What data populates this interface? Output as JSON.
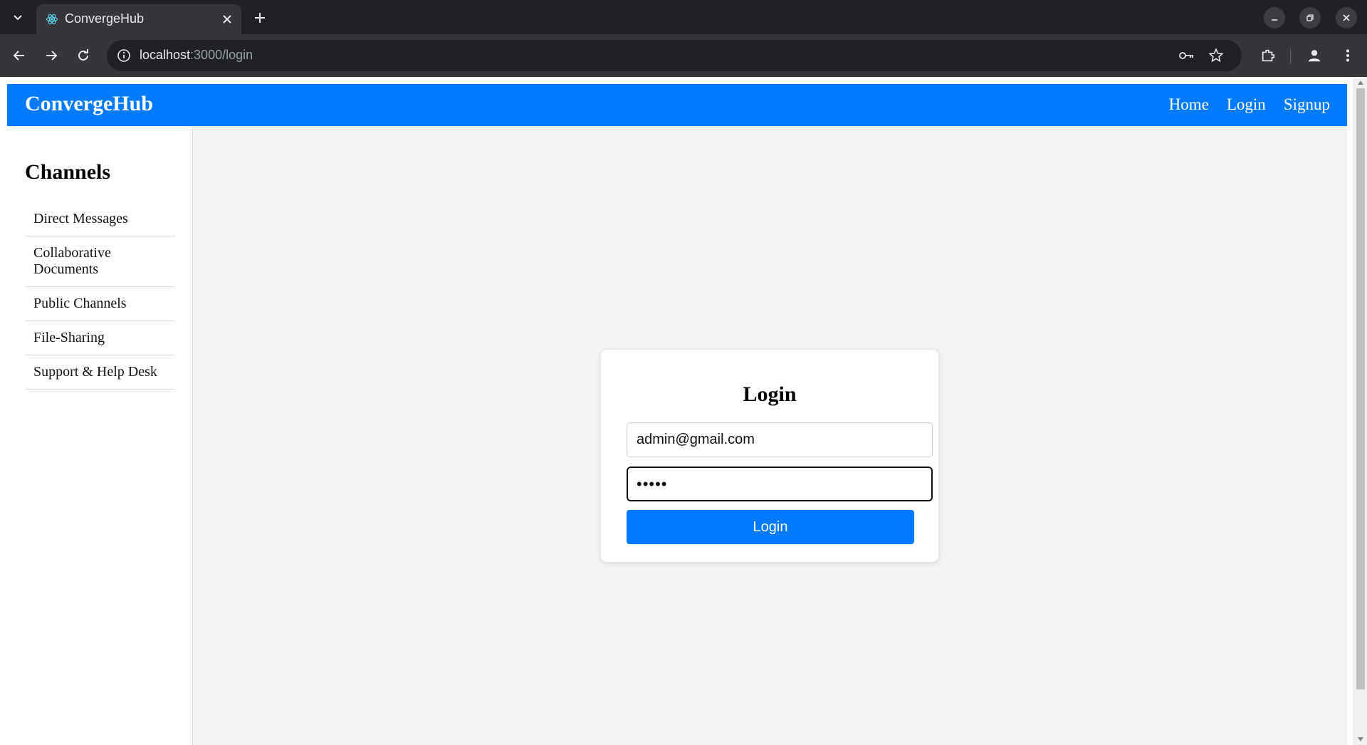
{
  "browser": {
    "tab_title": "ConvergeHub",
    "url_host": "localhost",
    "url_path": ":3000/login",
    "icons": [
      "tab-search-icon",
      "react-favicon-icon",
      "close-icon",
      "plus-icon",
      "minimize-icon",
      "restore-icon",
      "close-window-icon",
      "back-icon",
      "forward-icon",
      "reload-icon",
      "info-icon",
      "key-icon",
      "star-icon",
      "extensions-icon",
      "profile-icon",
      "kebab-menu-icon"
    ]
  },
  "navbar": {
    "brand": "ConvergeHub",
    "links": [
      "Home",
      "Login",
      "Signup"
    ],
    "color": "#007bff"
  },
  "sidebar": {
    "title": "Channels",
    "items": [
      "Direct Messages",
      "Collaborative Documents",
      "Public Channels",
      "File-Sharing",
      "Support & Help Desk"
    ]
  },
  "login": {
    "title": "Login",
    "email_value": "admin@gmail.com",
    "password_mask": "•••••",
    "button_label": "Login"
  }
}
